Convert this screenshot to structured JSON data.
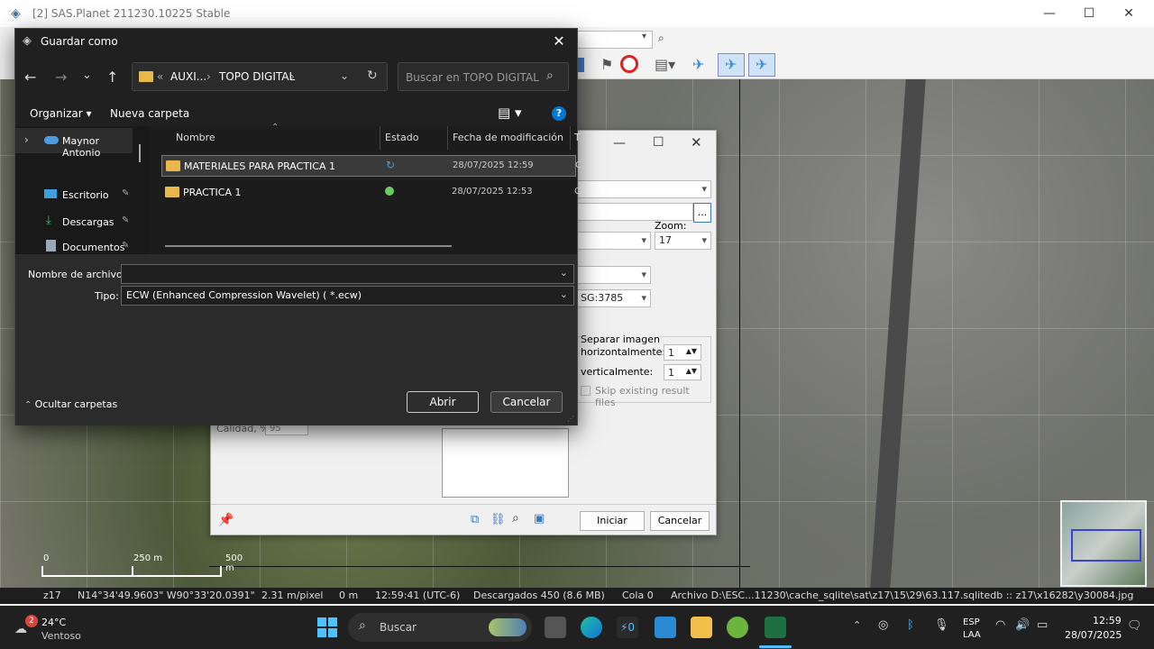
{
  "app": {
    "title": "[2] SAS.Planet 211230.10225 Stable",
    "window_controls": [
      "—",
      "☐",
      "✕"
    ]
  },
  "map": {
    "scale_labels": [
      "0",
      "250 m",
      "500 m"
    ]
  },
  "statusbar": {
    "zoom": "z17",
    "coords": "N14°34'49.9603\" W90°33'20.0391\"",
    "resolution": "2.31 m/pixel",
    "distance": "0 m",
    "time": "12:59:41 (UTC-6)",
    "downloaded": "Descargados 450 (8.6 MB)",
    "queue": "Cola 0",
    "file": "Archivo D:\\ESC...11230\\cache_sqlite\\sat\\z17\\15\\29\\63.117.sqlitedb :: z17\\x16282\\y30084.jpg"
  },
  "bgdialog": {
    "zoom_label": "Zoom:",
    "zoom_value": "17",
    "projection_value": "SG:3785",
    "split_label": "Separar imagen",
    "horiz_label": "horizontalmente:",
    "horiz_value": "1",
    "vert_label": "verticalmente:",
    "vert_value": "1",
    "skip_label": "Skip existing result files",
    "quality_label": "Calidad, %",
    "quality_value": "95",
    "browse_label": "...",
    "start_button": "Iniciar",
    "cancel_button": "Cancelar"
  },
  "dialog": {
    "title": "Guardar como",
    "path": {
      "prefix": "«",
      "segments": [
        "AUXI...",
        "TOPO DIGITAL"
      ]
    },
    "search_placeholder": "Buscar en TOPO DIGITAL",
    "organize": "Organizar",
    "new_folder": "Nueva carpeta",
    "nav_items": [
      {
        "label": "Maynor Antonio",
        "icon": "cloud-icon"
      },
      {
        "label": "Escritorio",
        "icon": "desktop-icon"
      },
      {
        "label": "Descargas",
        "icon": "download-icon"
      },
      {
        "label": "Documentos",
        "icon": "documents-icon"
      }
    ],
    "columns": [
      "Nombre",
      "Estado",
      "Fecha de modificación",
      "T"
    ],
    "files": [
      {
        "name": "MATERIALES PARA PRACTICA 1",
        "status": "sync-icon",
        "date": "28/07/2025 12:59",
        "type": "C"
      },
      {
        "name": "PRACTICA 1",
        "status": "check-icon",
        "date": "28/07/2025 12:53",
        "type": "C"
      }
    ],
    "filename_label": "Nombre de archivo:",
    "filename_value": "",
    "type_label": "Tipo:",
    "type_value": "ECW (Enhanced Compression Wavelet)  ( *.ecw)",
    "hide_folders": "Ocultar carpetas",
    "open_button": "Abrir",
    "cancel_button": "Cancelar"
  },
  "taskbar": {
    "weather_temp": "24°C",
    "weather_desc": "Ventoso",
    "weather_badge": "2",
    "search_label": "Buscar",
    "lang_top": "ESP",
    "lang_bottom": "LAA",
    "clock_time": "12:59",
    "clock_date": "28/07/2025"
  },
  "colors": {
    "accent": "#0078d4",
    "dialog_bg": "#202020",
    "folder": "#e8b84a",
    "check": "#6ccb5f"
  }
}
